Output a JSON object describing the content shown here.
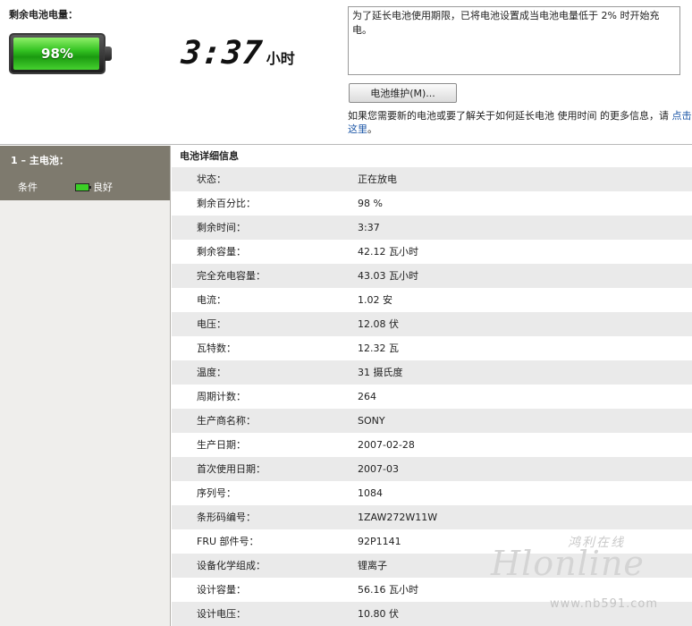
{
  "top": {
    "remaining_label": "剩余电池电量：",
    "battery_percent_text": "98%",
    "battery_level": 0.98,
    "time_value": "3:37",
    "time_unit": "小时",
    "notice_text": "为了延长电池使用期限，已将电池设置成当电池电量低于 2% 时开始充电。",
    "maintenance_button": "电池维护(M)...",
    "info_text": "如果您需要新的电池或要了解关于如何延长电池 使用时间 的更多信息，请 ",
    "info_link": "点击这里",
    "info_tail": "。"
  },
  "sidebar": {
    "title": "1 – 主电池：",
    "condition_label": "条件",
    "condition_value": "良好"
  },
  "details": {
    "title": "电池详细信息",
    "rows": [
      {
        "k": "状态：",
        "v": "正在放电"
      },
      {
        "k": "剩余百分比：",
        "v": "98 %"
      },
      {
        "k": "剩余时间：",
        "v": "3:37"
      },
      {
        "k": "剩余容量：",
        "v": "42.12 瓦小时"
      },
      {
        "k": "完全充电容量：",
        "v": "43.03 瓦小时"
      },
      {
        "k": "电流：",
        "v": "1.02 安"
      },
      {
        "k": "电压：",
        "v": "12.08 伏"
      },
      {
        "k": "瓦特数：",
        "v": "12.32 瓦"
      },
      {
        "k": "温度：",
        "v": "31 摄氏度"
      },
      {
        "k": "周期计数：",
        "v": "264"
      },
      {
        "k": "生产商名称：",
        "v": "SONY"
      },
      {
        "k": "生产日期：",
        "v": "2007-02-28"
      },
      {
        "k": "首次使用日期：",
        "v": "2007-03"
      },
      {
        "k": "序列号：",
        "v": "1084"
      },
      {
        "k": "条形码编号：",
        "v": "1ZAW272W11W"
      },
      {
        "k": "FRU 部件号：",
        "v": "92P1141"
      },
      {
        "k": "设备化学组成：",
        "v": "锂离子"
      },
      {
        "k": "设计容量：",
        "v": "56.16 瓦小时"
      },
      {
        "k": "设计电压：",
        "v": "10.80 伏"
      }
    ]
  },
  "watermark": {
    "cn": "鸿利在线",
    "logo": "Hlonline",
    "url": "www.nb591.com"
  },
  "colors": {
    "sidebar_header": "#7e7a6e",
    "battery_green": "#34c322",
    "link_blue": "#1a55a6"
  }
}
